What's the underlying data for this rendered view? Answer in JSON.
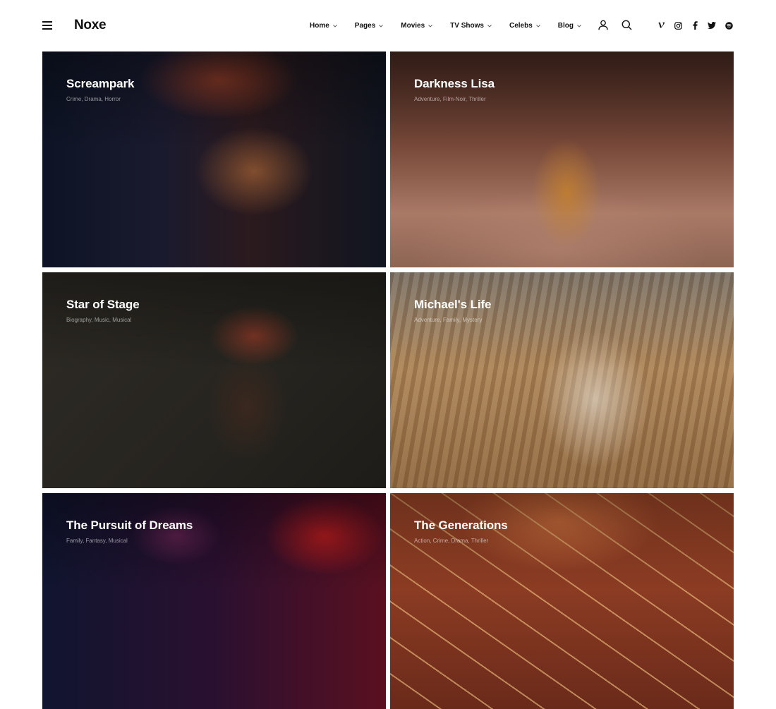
{
  "header": {
    "logo": "Noxe",
    "nav": [
      {
        "label": "Home"
      },
      {
        "label": "Pages"
      },
      {
        "label": "Movies"
      },
      {
        "label": "TV Shows"
      },
      {
        "label": "Celebs"
      },
      {
        "label": "Blog"
      }
    ],
    "icons": [
      "menu-icon",
      "user-icon",
      "search-icon"
    ],
    "social": [
      "vimeo-icon",
      "instagram-icon",
      "facebook-icon",
      "twitter-icon",
      "spotify-icon"
    ]
  },
  "movies": [
    {
      "title": "Screampark",
      "genres": "Crime, Drama, Horror"
    },
    {
      "title": "Darkness Lisa",
      "genres": "Adventure, Film-Noir, Thriller"
    },
    {
      "title": "Star of Stage",
      "genres": "Biography, Music, Musical"
    },
    {
      "title": "Michael's Life",
      "genres": "Adventure, Family, Mystery"
    },
    {
      "title": "The Pursuit of Dreams",
      "genres": "Family, Fantasy, Musical"
    },
    {
      "title": "The Generations",
      "genres": "Action, Crime, Drama, Thriller"
    }
  ],
  "colors": {
    "text": "#111111",
    "background": "#ffffff",
    "card_text": "#ffffff"
  }
}
